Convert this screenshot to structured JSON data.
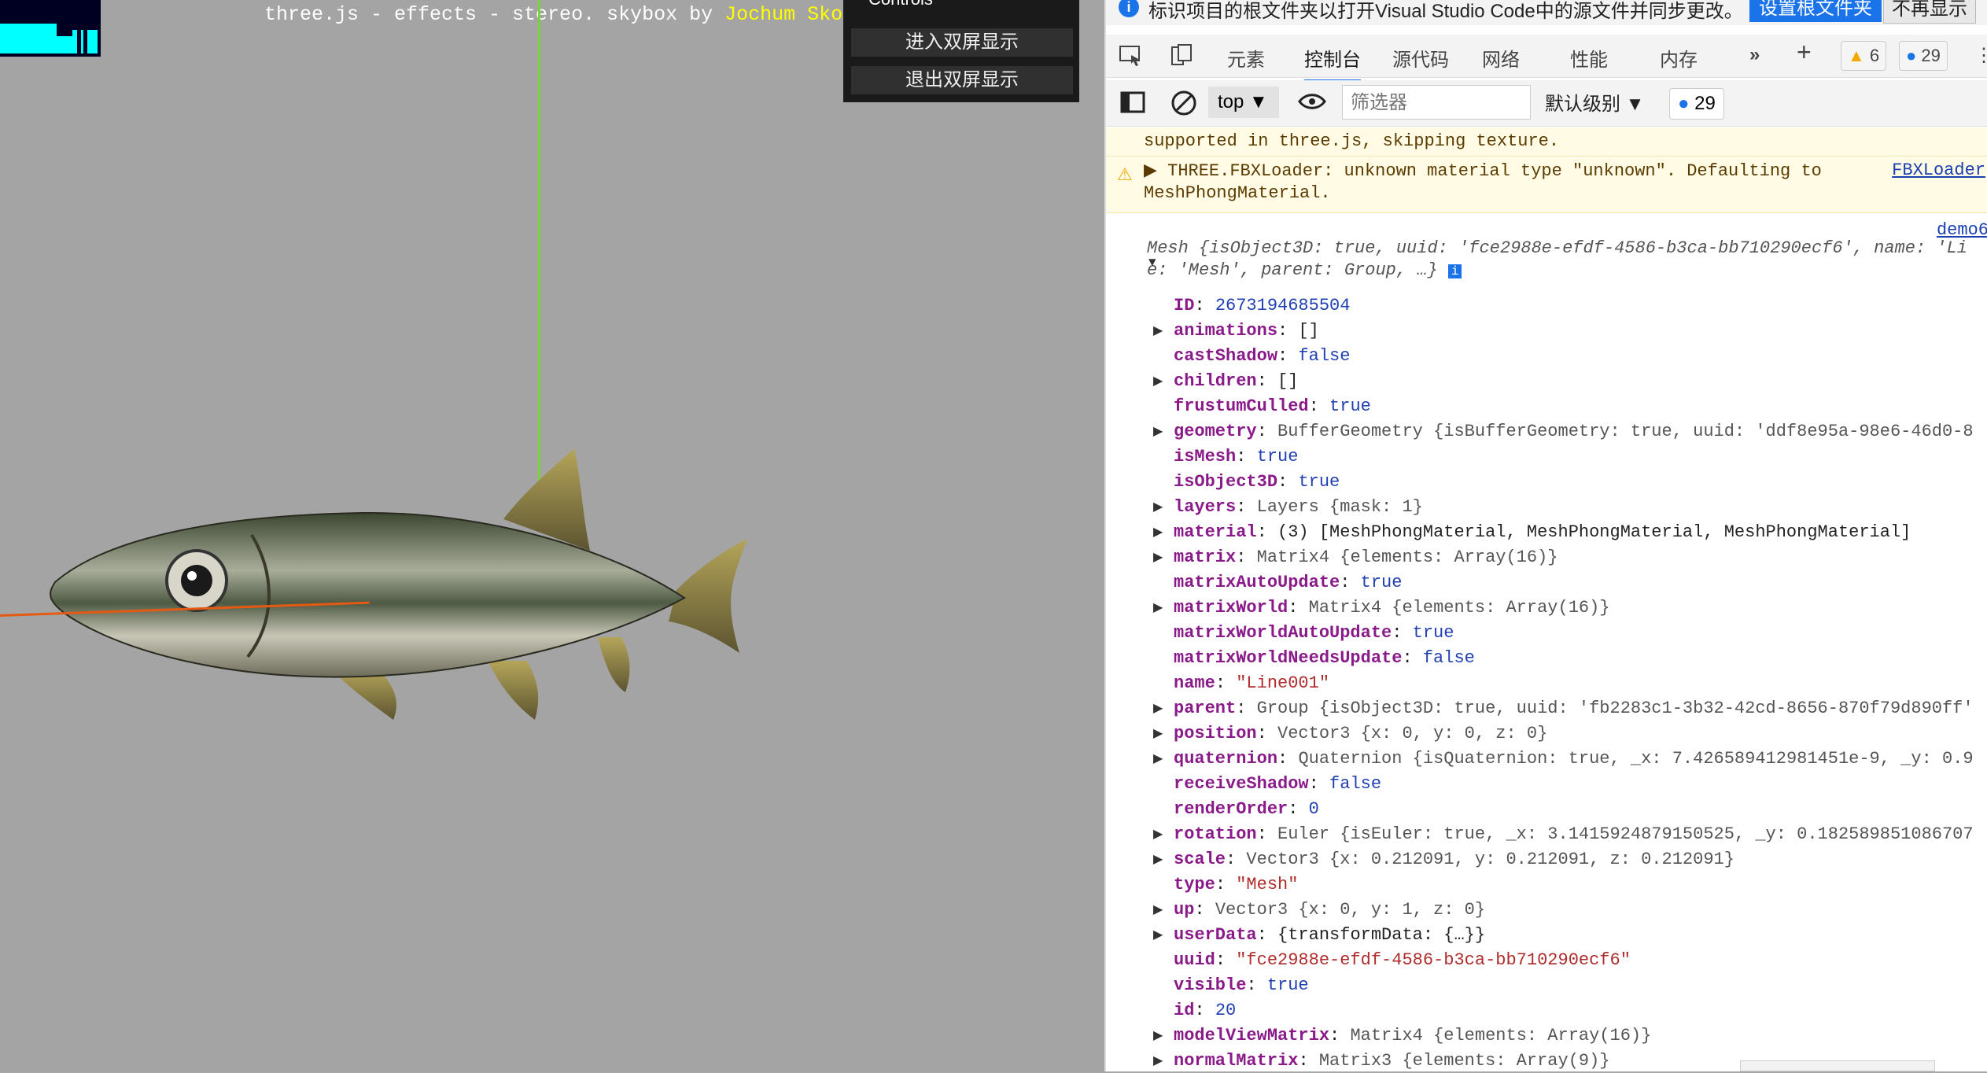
{
  "scene": {
    "info_plain": "three.js - effects - stereo. skybox by ",
    "info_link": "Jochum Skoglund",
    "controls_title": "Controls",
    "btn_enter": "进入双屏显示",
    "btn_exit": "退出双屏显示"
  },
  "devtools": {
    "notice": "标识项目的根文件夹以打开Visual Studio Code中的源文件并同步更改。",
    "notice_btn_set": "设置根文件夹",
    "notice_btn_dismiss": "不再显示",
    "tabs": [
      "元素",
      "控制台",
      "源代码",
      "网络",
      "性能",
      "内存"
    ],
    "active_tab": "控制台",
    "warn_count": "6",
    "msg_count": "29",
    "context": "top",
    "filter_placeholder": "筛选器",
    "level": "默认级别",
    "issues_count": "29",
    "warn1": "supported in three.js, skipping texture.",
    "warn2_line1": "▶ THREE.FBXLoader: unknown material type \"unknown\". Defaulting to",
    "warn2_line2": "MeshPhongMaterial.",
    "warn2_src": "FBXLoader",
    "demo_src": "demo6",
    "obj_line1": "Mesh {isObject3D: true, uuid: 'fce2988e-efdf-4586-b3ca-bb710290ecf6', name: 'Li",
    "obj_line2": "e: 'Mesh', parent: Group, …}",
    "props": [
      {
        "arrow": "",
        "key": "ID",
        "val": "2673194685504",
        "cls": "num"
      },
      {
        "arrow": "▶",
        "key": "animations",
        "val": "[]",
        "cls": ""
      },
      {
        "arrow": "",
        "key": "castShadow",
        "val": "false",
        "cls": "num"
      },
      {
        "arrow": "▶",
        "key": "children",
        "val": "[]",
        "cls": ""
      },
      {
        "arrow": "",
        "key": "frustumCulled",
        "val": "true",
        "cls": "num"
      },
      {
        "arrow": "▶",
        "key": "geometry",
        "val": "BufferGeometry {isBufferGeometry: true, uuid: 'ddf8e95a-98e6-46d0-8",
        "cls": "cls"
      },
      {
        "arrow": "",
        "key": "isMesh",
        "val": "true",
        "cls": "num"
      },
      {
        "arrow": "",
        "key": "isObject3D",
        "val": "true",
        "cls": "num"
      },
      {
        "arrow": "▶",
        "key": "layers",
        "val": "Layers {mask: 1}",
        "cls": "cls"
      },
      {
        "arrow": "▶",
        "key": "material",
        "val": "(3) [MeshPhongMaterial, MeshPhongMaterial, MeshPhongMaterial]",
        "cls": ""
      },
      {
        "arrow": "▶",
        "key": "matrix",
        "val": "Matrix4 {elements: Array(16)}",
        "cls": "cls"
      },
      {
        "arrow": "",
        "key": "matrixAutoUpdate",
        "val": "true",
        "cls": "num"
      },
      {
        "arrow": "▶",
        "key": "matrixWorld",
        "val": "Matrix4 {elements: Array(16)}",
        "cls": "cls"
      },
      {
        "arrow": "",
        "key": "matrixWorldAutoUpdate",
        "val": "true",
        "cls": "num"
      },
      {
        "arrow": "",
        "key": "matrixWorldNeedsUpdate",
        "val": "false",
        "cls": "num"
      },
      {
        "arrow": "",
        "key": "name",
        "val": "\"Line001\"",
        "cls": "str"
      },
      {
        "arrow": "▶",
        "key": "parent",
        "val": "Group {isObject3D: true, uuid: 'fb2283c1-3b32-42cd-8656-870f79d890ff'",
        "cls": "cls"
      },
      {
        "arrow": "▶",
        "key": "position",
        "val": "Vector3 {x: 0, y: 0, z: 0}",
        "cls": "cls"
      },
      {
        "arrow": "▶",
        "key": "quaternion",
        "val": "Quaternion {isQuaternion: true, _x: 7.426589412981451e-9, _y: 0.9",
        "cls": "cls"
      },
      {
        "arrow": "",
        "key": "receiveShadow",
        "val": "false",
        "cls": "num"
      },
      {
        "arrow": "",
        "key": "renderOrder",
        "val": "0",
        "cls": "num"
      },
      {
        "arrow": "▶",
        "key": "rotation",
        "val": "Euler {isEuler: true, _x: 3.1415924879150525, _y: 0.182589851086707",
        "cls": "cls"
      },
      {
        "arrow": "▶",
        "key": "scale",
        "val": "Vector3 {x: 0.212091, y: 0.212091, z: 0.212091}",
        "cls": "cls"
      },
      {
        "arrow": "",
        "key": "type",
        "val": "\"Mesh\"",
        "cls": "str"
      },
      {
        "arrow": "▶",
        "key": "up",
        "val": "Vector3 {x: 0, y: 1, z: 0}",
        "cls": "cls"
      },
      {
        "arrow": "▶",
        "key": "userData",
        "val": "{transformData: {…}}",
        "cls": ""
      },
      {
        "arrow": "",
        "key": "uuid",
        "val": "\"fce2988e-efdf-4586-b3ca-bb710290ecf6\"",
        "cls": "str"
      },
      {
        "arrow": "",
        "key": "visible",
        "val": "true",
        "cls": "num"
      },
      {
        "arrow": "",
        "key": "id",
        "val": "20",
        "cls": "num"
      },
      {
        "arrow": "▶",
        "key": "modelViewMatrix",
        "val": "Matrix4 {elements: Array(16)}",
        "cls": "cls"
      },
      {
        "arrow": "▶",
        "key": "normalMatrix",
        "val": "Matrix3 {elements: Array(9)}",
        "cls": "cls"
      }
    ]
  }
}
